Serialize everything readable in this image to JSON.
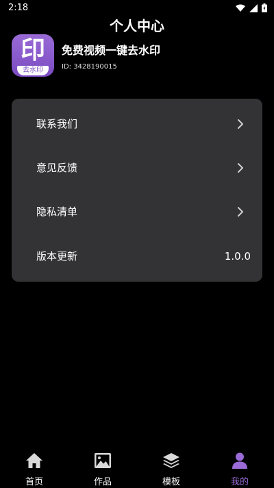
{
  "status_bar": {
    "time": "2:18"
  },
  "header": {
    "title": "个人中心"
  },
  "profile": {
    "logo_char": "印",
    "logo_sub": "去水印",
    "app_name": "免费视频一键去水印",
    "id_text": "ID: 3428190015"
  },
  "menu": {
    "items": [
      {
        "label": "联系我们"
      },
      {
        "label": "意见反馈"
      },
      {
        "label": "隐私清单"
      },
      {
        "label": "版本更新",
        "value": "1.0.0"
      }
    ]
  },
  "bottom_nav": {
    "items": [
      {
        "label": "首页",
        "icon": "home-icon"
      },
      {
        "label": "作品",
        "icon": "image-icon"
      },
      {
        "label": "模板",
        "icon": "layers-icon"
      },
      {
        "label": "我的",
        "icon": "user-icon"
      }
    ],
    "active_index": 3
  },
  "colors": {
    "accent": "#9a6bd6",
    "card_bg": "#333335",
    "background": "#000000"
  }
}
